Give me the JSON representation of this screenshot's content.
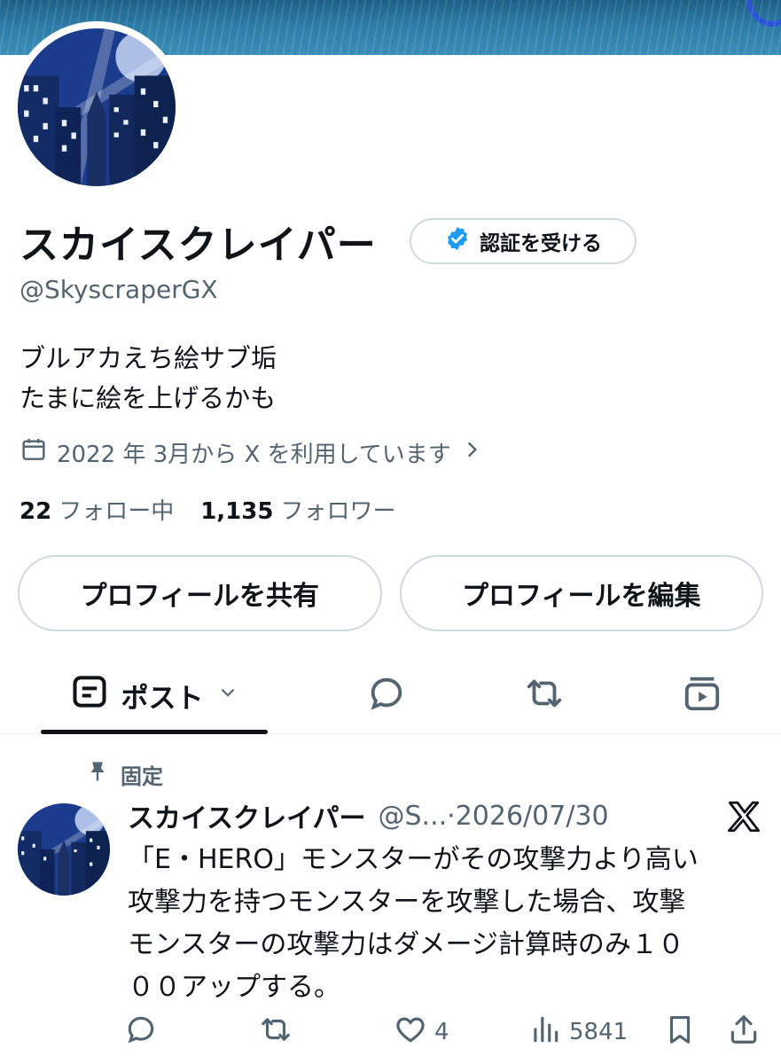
{
  "profile": {
    "display_name": "スカイスクレイパー",
    "verify_button_label": "認証を受ける",
    "handle": "@SkyscraperGX",
    "bio_lines": [
      "ブルアカえち絵サブ垢",
      "たまに絵を上げるかも"
    ],
    "joined_text": "2022 年 3月から X を利用しています",
    "following_count": "22",
    "following_label": "フォロー中",
    "followers_count": "1,135",
    "followers_label": "フォロワー",
    "share_button_label": "プロフィールを共有",
    "edit_button_label": "プロフィールを編集"
  },
  "tabs": {
    "posts_label": "ポスト",
    "icons": [
      "posts-icon",
      "replies-icon",
      "reposts-icon",
      "media-icon"
    ]
  },
  "pinned_tweet": {
    "pinned_label": "固定",
    "author_name": "スカイスクレイパー",
    "author_handle": "@S...",
    "separator": "·",
    "date": "2026/07/30",
    "text_lines": [
      "「E・HERO」モンスターがその攻撃力より高い",
      "攻撃力を持つモンスターを攻撃した場合、攻撃",
      "モンスターの攻撃力はダメージ計算時のみ１０",
      "００アップする。"
    ],
    "like_count": "4",
    "view_count": "5841"
  },
  "colors": {
    "text_primary": "#0f1419",
    "text_secondary": "#536471",
    "border": "#cfd9de",
    "verified_blue": "#1d9bf0",
    "banner": "#2b7ba6"
  }
}
